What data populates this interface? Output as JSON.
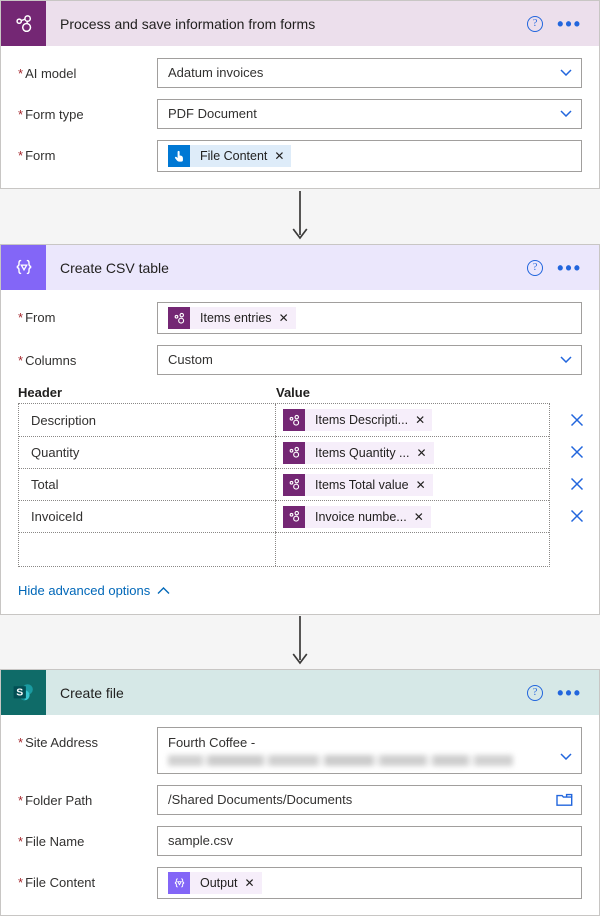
{
  "cards": [
    {
      "id": "process-forms",
      "title": "Process and save information from forms",
      "icon": "ai-builder-icon",
      "help_label": "?",
      "menu_label": "•••",
      "fields": [
        {
          "label": "AI model",
          "required": true,
          "type": "dropdown",
          "value": "Adatum invoices"
        },
        {
          "label": "Form type",
          "required": true,
          "type": "dropdown",
          "value": "PDF Document"
        },
        {
          "label": "Form",
          "required": true,
          "type": "token",
          "token": {
            "label": "File Content",
            "icon": "manual-trigger-icon",
            "icon_style": "blue",
            "chip_style": "blue-token",
            "remove_label": "✕"
          }
        }
      ]
    },
    {
      "id": "create-csv-table",
      "title": "Create CSV table",
      "icon": "data-operation-icon",
      "help_label": "?",
      "menu_label": "•••",
      "fields": [
        {
          "label": "From",
          "required": true,
          "type": "token",
          "token": {
            "label": "Items entries",
            "icon": "ai-builder-icon",
            "icon_style": "purple",
            "chip_style": "",
            "remove_label": "✕"
          }
        },
        {
          "label": "Columns",
          "required": true,
          "type": "dropdown",
          "value": "Custom"
        }
      ],
      "table": {
        "col_header": "Header",
        "col_value": "Value",
        "rows": [
          {
            "key": "Description",
            "token": {
              "label": "Items Descripti...",
              "icon": "ai-builder-icon",
              "remove_label": "✕"
            },
            "delete_label": "✕"
          },
          {
            "key": "Quantity",
            "token": {
              "label": "Items Quantity ...",
              "icon": "ai-builder-icon",
              "remove_label": "✕"
            },
            "delete_label": "✕"
          },
          {
            "key": "Total",
            "token": {
              "label": "Items Total value",
              "icon": "ai-builder-icon",
              "remove_label": "✕"
            },
            "delete_label": "✕"
          },
          {
            "key": "InvoiceId",
            "token": {
              "label": "Invoice numbe...",
              "icon": "ai-builder-icon",
              "remove_label": "✕"
            },
            "delete_label": "✕"
          },
          {
            "key": "",
            "token": null,
            "delete_label": ""
          }
        ]
      },
      "advanced_options": {
        "label": "Hide advanced options",
        "icon": "chevron-up-icon"
      }
    },
    {
      "id": "create-file",
      "title": "Create file",
      "icon": "sharepoint-icon",
      "help_label": "?",
      "menu_label": "•••",
      "fields": [
        {
          "label": "Site Address",
          "required": true,
          "type": "site",
          "value": "Fourth Coffee -",
          "redacted_second_line": true
        },
        {
          "label": "Folder Path",
          "required": true,
          "type": "folder",
          "value": "/Shared Documents/Documents"
        },
        {
          "label": "File Name",
          "required": true,
          "type": "text",
          "value": "sample.csv"
        },
        {
          "label": "File Content",
          "required": true,
          "type": "token",
          "token": {
            "label": "Output",
            "icon": "data-operation-icon",
            "icon_style": "violet",
            "chip_style": "",
            "remove_label": "✕"
          }
        }
      ]
    }
  ],
  "connectors": [
    {
      "icon": "down-arrow-icon"
    },
    {
      "icon": "down-arrow-icon"
    }
  ],
  "colors": {
    "ai_builder_purple": "#742774",
    "data_operation_violet": "#8366f7",
    "sharepoint_teal": "#0f6b68",
    "trigger_blue": "#0078d4",
    "link_blue": "#0067b8",
    "required_red": "#a4262c",
    "canvas_gray": "#f5f5f5"
  }
}
